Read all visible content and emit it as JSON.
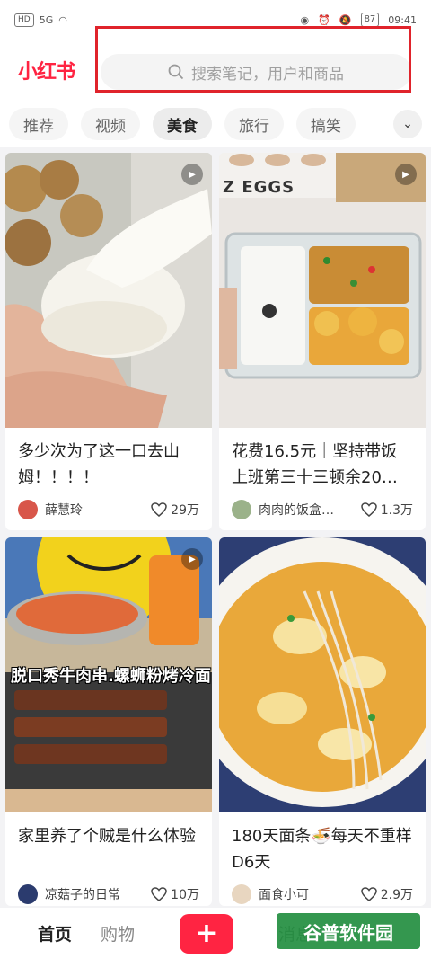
{
  "status_bar": {
    "hd": "HD",
    "signal": "5G",
    "battery": "87",
    "time": "09:41"
  },
  "header": {
    "logo": "小红书",
    "search_placeholder": "搜索笔记，用户和商品"
  },
  "tabs": [
    {
      "label": "推荐"
    },
    {
      "label": "视频"
    },
    {
      "label": "美食"
    },
    {
      "label": "旅行"
    },
    {
      "label": "搞笑"
    }
  ],
  "active_tab": "美食",
  "cards": [
    {
      "title": "多少次为了这一口去山姆！！！！",
      "user": "薛慧玲",
      "likes": "29万"
    },
    {
      "title": "花费16.5元｜坚持带饭上班第三十三顿余20…",
      "user": "肉肉的饭盒…",
      "likes": "1.3万",
      "image_text": "Z EGGS"
    },
    {
      "title": "家里养了个贼是什么体验",
      "user": "凉菇子的日常",
      "likes": "10万",
      "image_text": "脱口秀牛肉串.螺蛳粉烤冷面"
    },
    {
      "title": "180天面条🍜每天不重样D6天",
      "user": "面食小可",
      "likes": "2.9万"
    }
  ],
  "bottom_nav": {
    "home": "首页",
    "shop": "购物",
    "plus": "+",
    "messages": "消息"
  },
  "watermark": "谷普软件园",
  "colors": {
    "brand": "#ff2442",
    "highlight_box": "#e0232b"
  }
}
